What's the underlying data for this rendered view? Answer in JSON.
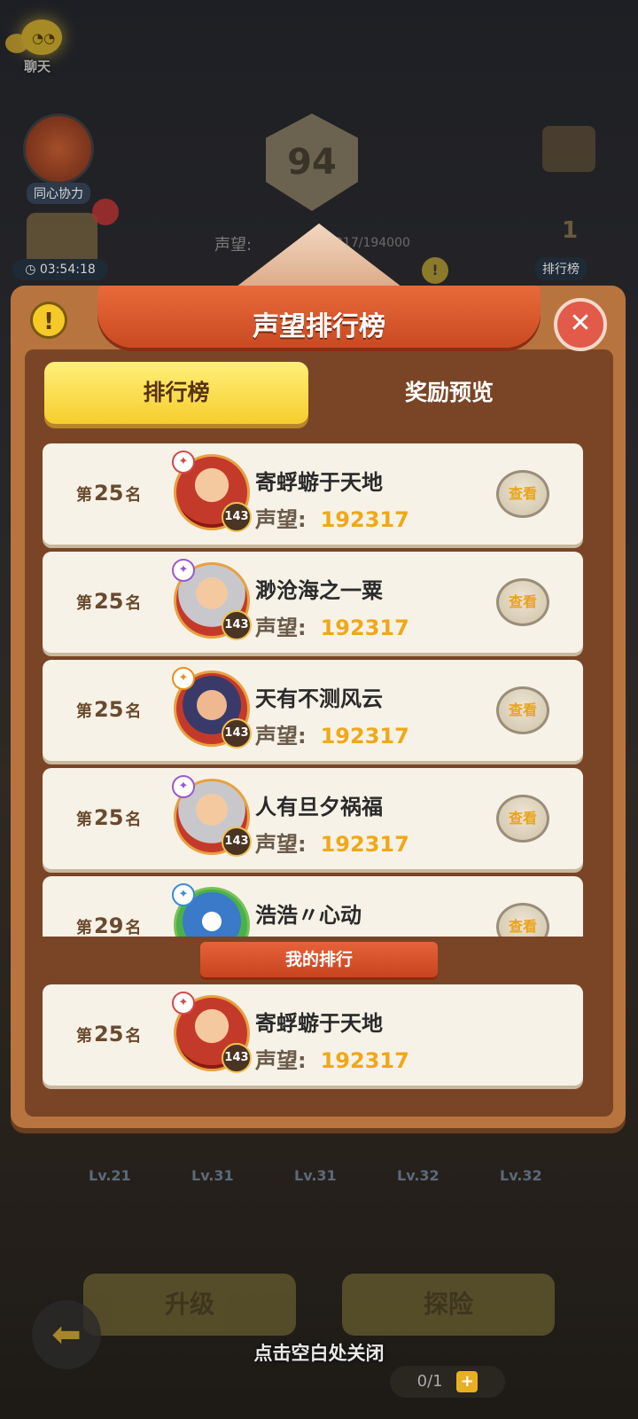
{
  "chat": {
    "label": "聊天",
    "icon": "chat-face-icon"
  },
  "coop": {
    "label": "同心协力"
  },
  "timer": {
    "value": "03:54:18"
  },
  "level_badge": {
    "value": "94"
  },
  "background_prestige": {
    "label": "声望:",
    "value": "317/194000"
  },
  "leaderboard_shortcut": {
    "label": "排行榜",
    "podium_rank": "1"
  },
  "panel": {
    "title": "声望排行榜",
    "close_symbol": "✕",
    "info_symbol": "!"
  },
  "tabs": [
    {
      "label": "排行榜",
      "active": true
    },
    {
      "label": "奖励预览",
      "active": false
    }
  ],
  "rank_prefix": "第",
  "rank_suffix": "名",
  "prestige_label": "声望:",
  "view_label": "查看",
  "list": [
    {
      "rank": "25",
      "name": "寄蜉蝣于天地",
      "level": "143",
      "prestige": "192317",
      "class_icon": "flame-class-icon"
    },
    {
      "rank": "25",
      "name": "渺沧海之一粟",
      "level": "143",
      "prestige": "192317",
      "class_icon": "swirl-class-icon"
    },
    {
      "rank": "25",
      "name": "天有不测风云",
      "level": "143",
      "prestige": "192317",
      "class_icon": "sword-class-icon"
    },
    {
      "rank": "25",
      "name": "人有旦夕祸福",
      "level": "143",
      "prestige": "192317",
      "class_icon": "orb-class-icon"
    },
    {
      "rank": "29",
      "name": "浩浩〃心动",
      "level": "",
      "prestige": "",
      "class_icon": "wing-class-icon"
    }
  ],
  "my_rank": {
    "banner": "我的排行",
    "rank": "25",
    "name": "寄蜉蝣于天地",
    "level": "143",
    "prestige": "192317"
  },
  "bottom": {
    "levels": [
      "Lv.21",
      "Lv.31",
      "Lv.31",
      "Lv.32",
      "Lv.32"
    ],
    "upgrade_label": "升级",
    "explore_label": "探险",
    "close_hint": "点击空白处关闭",
    "food_count": "0/1",
    "food_plus": "+"
  }
}
